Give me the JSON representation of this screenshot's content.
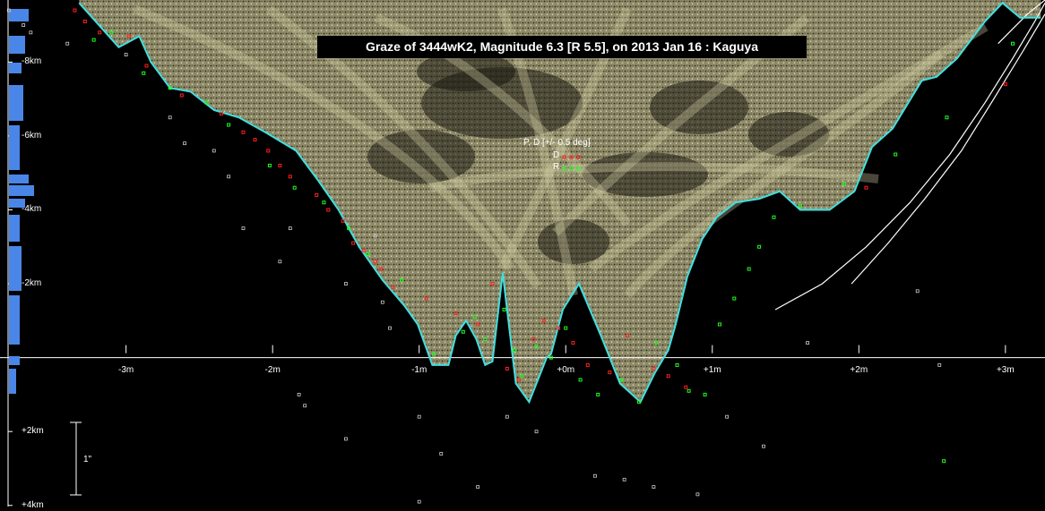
{
  "chart_data": {
    "type": "scatter",
    "title": "Graze of  3444wK2,  Magnitude 6.3 [R 5.5],  on 2013 Jan 16  :  Kaguya",
    "x_ticks": [
      "-3m",
      "-2m",
      "-1m",
      "+0m",
      "+1m",
      "+2m",
      "+3m"
    ],
    "y_ticks": [
      "-8km",
      "-6km",
      "-4km",
      "-2km",
      "+2km",
      "+4km"
    ],
    "xlim": [
      -3.86,
      3.27
    ],
    "ylim": [
      4.03,
      -9.68
    ],
    "scale_bar_label": "1\"",
    "legend": {
      "title": "P, D [+/- 0.5 deg]",
      "items": [
        {
          "label": "D",
          "color": "#ff2020"
        },
        {
          "label": "R",
          "color": "#20ff20"
        }
      ]
    },
    "profile_color": "#40e0e0",
    "terrain_color": "#b8b48a",
    "limb_profile": {
      "x": [
        -3.32,
        -3.05,
        -2.91,
        -2.83,
        -2.7,
        -2.56,
        -2.4,
        -2.23,
        -2.05,
        -1.84,
        -1.69,
        -1.55,
        -1.41,
        -1.25,
        -1.1,
        -1.01,
        -0.91,
        -0.8,
        -0.75,
        -0.68,
        -0.61,
        -0.55,
        -0.5,
        -0.43,
        -0.34,
        -0.25,
        -0.13,
        -0.1,
        -0.02,
        0.09,
        0.25,
        0.37,
        0.51,
        0.61,
        0.7,
        0.75,
        0.83,
        0.93,
        1.03,
        1.16,
        1.32,
        1.46,
        1.6,
        1.8,
        1.97,
        2.09,
        2.23,
        2.43,
        2.53,
        2.67,
        2.86,
        2.98,
        3.1,
        3.24
      ],
      "y": [
        -9.6,
        -8.4,
        -8.7,
        -8.0,
        -7.3,
        -7.2,
        -6.7,
        -6.5,
        -6.1,
        -5.6,
        -4.8,
        -4.0,
        -3.0,
        -2.1,
        -1.4,
        -0.9,
        0.2,
        0.2,
        -0.6,
        -1.0,
        -0.5,
        0.2,
        0.1,
        -2.3,
        0.7,
        1.2,
        0.0,
        -0.1,
        -1.3,
        -2.0,
        -0.5,
        0.7,
        1.2,
        0.4,
        -0.2,
        -0.9,
        -2.2,
        -3.2,
        -3.8,
        -4.2,
        -4.3,
        -4.5,
        -4.0,
        -4.0,
        -4.5,
        -5.7,
        -6.2,
        -7.5,
        -7.6,
        -8.1,
        -9.1,
        -9.6,
        -9.2,
        -9.2
      ]
    },
    "d_points": {
      "x": [
        -3.35,
        -3.28,
        -3.18,
        -2.98,
        -2.86,
        -2.62,
        -2.35,
        -2.2,
        -2.12,
        -2.03,
        -1.95,
        -1.88,
        -1.7,
        -1.62,
        -1.52,
        -1.45,
        -1.38,
        -1.3,
        -1.26,
        -1.18,
        -0.95,
        -0.75,
        -0.6,
        -0.5,
        -0.4,
        -0.32,
        -0.22,
        -0.15,
        -0.05,
        0.05,
        0.15,
        0.3,
        0.42,
        0.6,
        0.7,
        0.82,
        3.0,
        2.05
      ],
      "y": [
        -9.4,
        -9.1,
        -8.8,
        -8.7,
        -7.9,
        -7.1,
        -6.6,
        -6.1,
        -5.9,
        -5.6,
        -5.2,
        -4.9,
        -4.4,
        -4.0,
        -3.7,
        -3.1,
        -2.9,
        -2.6,
        -2.4,
        -1.9,
        -1.6,
        -1.2,
        -0.9,
        -2.0,
        0.3,
        0.6,
        -0.5,
        -1.0,
        -0.8,
        -0.4,
        0.2,
        0.4,
        -0.6,
        0.3,
        0.5,
        0.8,
        -7.4,
        -4.6
      ]
    },
    "r_points": {
      "x": [
        -3.22,
        -3.1,
        -2.88,
        -2.7,
        -2.45,
        -2.3,
        -2.02,
        -1.85,
        -1.65,
        -1.48,
        -1.35,
        -1.12,
        -0.9,
        -0.7,
        -0.62,
        -0.55,
        -0.42,
        -0.35,
        -0.3,
        -0.2,
        -0.1,
        0.0,
        0.1,
        0.22,
        0.38,
        0.5,
        0.62,
        0.76,
        0.84,
        0.95,
        1.05,
        1.15,
        1.25,
        1.32,
        1.42,
        1.6,
        1.9,
        2.25,
        2.6,
        3.05,
        2.58
      ],
      "y": [
        -8.6,
        -8.8,
        -7.7,
        -7.3,
        -6.9,
        -6.3,
        -5.2,
        -4.6,
        -4.2,
        -3.5,
        -2.8,
        -2.1,
        -0.1,
        -0.7,
        -1.1,
        -0.5,
        -1.3,
        -0.2,
        0.5,
        -0.3,
        0.0,
        -0.8,
        0.6,
        1.0,
        0.6,
        1.2,
        -0.4,
        0.2,
        0.9,
        1.0,
        -0.9,
        -1.6,
        -2.4,
        -3.0,
        -3.8,
        -4.1,
        -4.7,
        -5.5,
        -6.5,
        -8.5,
        2.8
      ]
    },
    "sparse_points": {
      "x": [
        -3.8,
        -3.7,
        -3.65,
        -3.4,
        -3.0,
        -2.7,
        -2.6,
        -2.4,
        -2.3,
        -2.2,
        -1.95,
        -1.88,
        -1.82,
        -1.78,
        -1.5,
        -1.3,
        -1.25,
        -1.2,
        -1.0,
        -0.85,
        -0.6,
        -0.4,
        -0.2,
        0.2,
        0.4,
        0.6,
        0.9,
        1.1,
        1.35,
        1.65,
        2.4,
        2.55,
        -1.5,
        -1.0
      ],
      "y": [
        -9.4,
        -9.0,
        -8.8,
        -8.5,
        -8.2,
        -6.5,
        -5.8,
        -5.6,
        -4.9,
        -3.5,
        -2.6,
        -3.5,
        1.0,
        1.3,
        -2.0,
        -3.3,
        -1.5,
        -0.8,
        1.6,
        2.6,
        3.5,
        1.6,
        2.0,
        3.2,
        3.3,
        3.5,
        3.7,
        1.6,
        2.4,
        -0.4,
        -1.8,
        0.2,
        2.2,
        3.9
      ]
    },
    "limb_curves_right": [
      {
        "x": [
          1.43,
          1.75,
          2.05,
          2.35,
          2.62,
          2.86,
          3.05,
          3.2,
          3.27
        ],
        "y": [
          -1.3,
          -2.0,
          -3.0,
          -4.2,
          -5.5,
          -6.9,
          -8.1,
          -9.1,
          -9.6
        ]
      },
      {
        "x": [
          1.95,
          2.2,
          2.45,
          2.7,
          2.92,
          3.12,
          3.27
        ],
        "y": [
          -2.0,
          -3.1,
          -4.3,
          -5.6,
          -7.0,
          -8.3,
          -9.3
        ]
      },
      {
        "x": [
          2.95,
          3.05,
          3.15,
          3.27
        ],
        "y": [
          -8.5,
          -8.9,
          -9.3,
          -9.68
        ]
      }
    ]
  }
}
